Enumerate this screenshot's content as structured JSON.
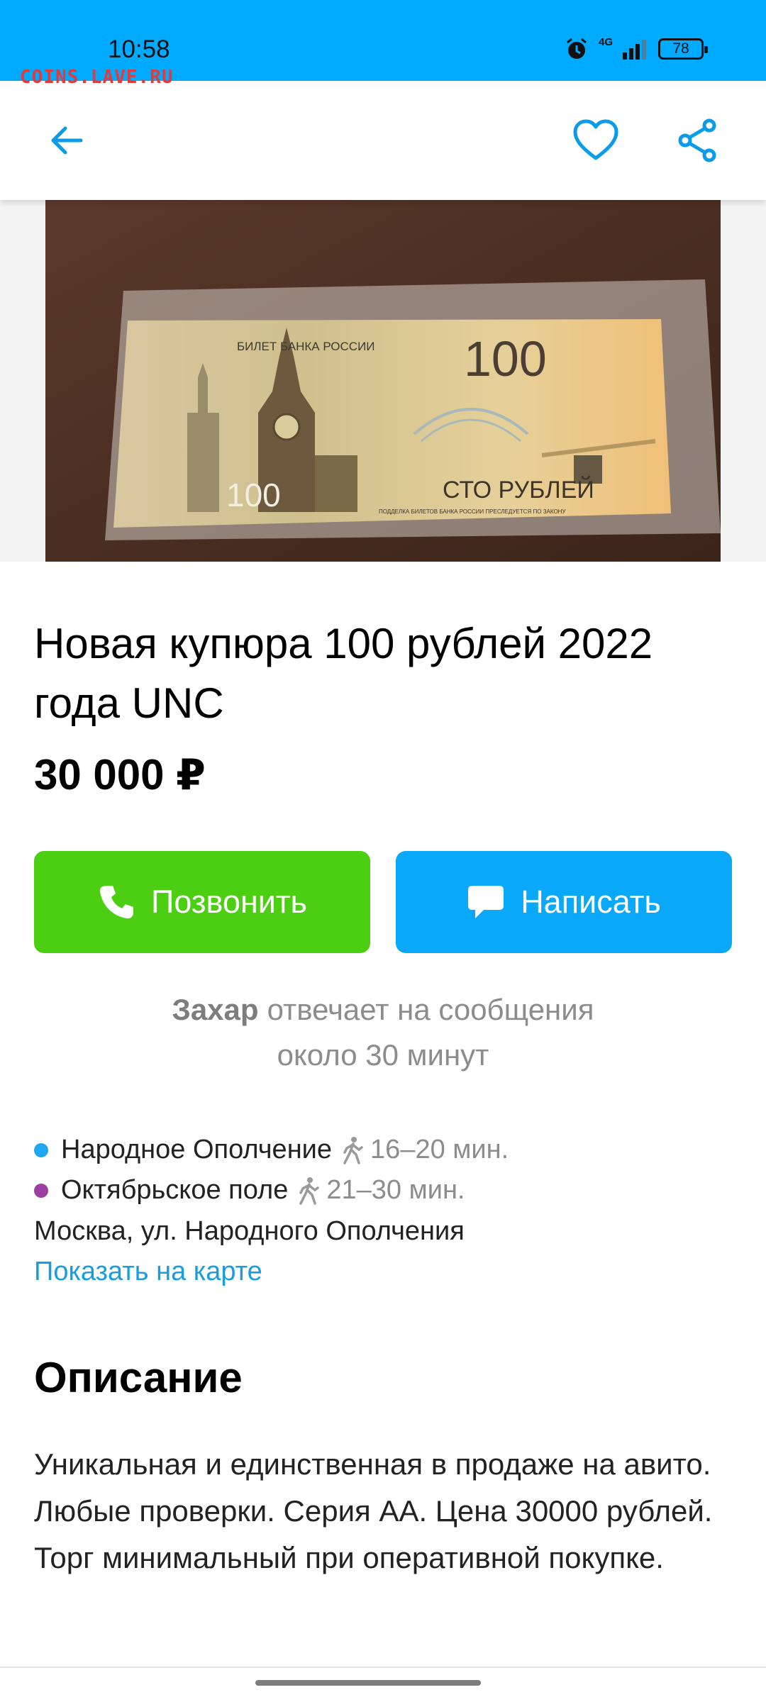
{
  "status_bar": {
    "time": "10:58",
    "network": "4G",
    "battery": "78",
    "watermark": "COINS.LAVE.RU"
  },
  "toolbar": {
    "back_icon": "arrow-left-icon",
    "favorite_icon": "heart-outline-icon",
    "share_icon": "share-icon"
  },
  "listing": {
    "title": "Новая купюра 100 рублей 2022 года UNC",
    "price": "30 000 ₽",
    "photo": {
      "banner_header": "БИЛЕТ БАНКА РОССИИ",
      "denomination": "100",
      "denomination_words": "СТО РУБЛЕЙ",
      "fine_print": "ПОДДЕЛКА БИЛЕТОВ БАНКА РОССИИ ПРЕСЛЕДУЕТСЯ ПО ЗАКОНУ"
    }
  },
  "actions": {
    "call_label": "Позвонить",
    "write_label": "Написать"
  },
  "seller": {
    "name": "Захар",
    "responds_text": "отвечает на сообщения",
    "responds_time": "около 30 минут"
  },
  "location": {
    "metro": [
      {
        "name": "Народное Ополчение",
        "time": "16–20 мин.",
        "color": "#1ea7f0"
      },
      {
        "name": "Октябрьское поле",
        "time": "21–30 мин.",
        "color": "#9c3fa0"
      }
    ],
    "address": "Москва, ул. Народного Ополчения",
    "map_link": "Показать на карте"
  },
  "description": {
    "heading": "Описание",
    "text": "Уникальная и единственная в продаже на авито. Любые проверки. Серия АА. Цена 30000 рублей. Торг минимальный при оперативной покупке."
  },
  "colors": {
    "accent": "#00aaff",
    "call_button": "#4ccf12",
    "write_button": "#0aa8f8",
    "link": "#1a9de0"
  }
}
